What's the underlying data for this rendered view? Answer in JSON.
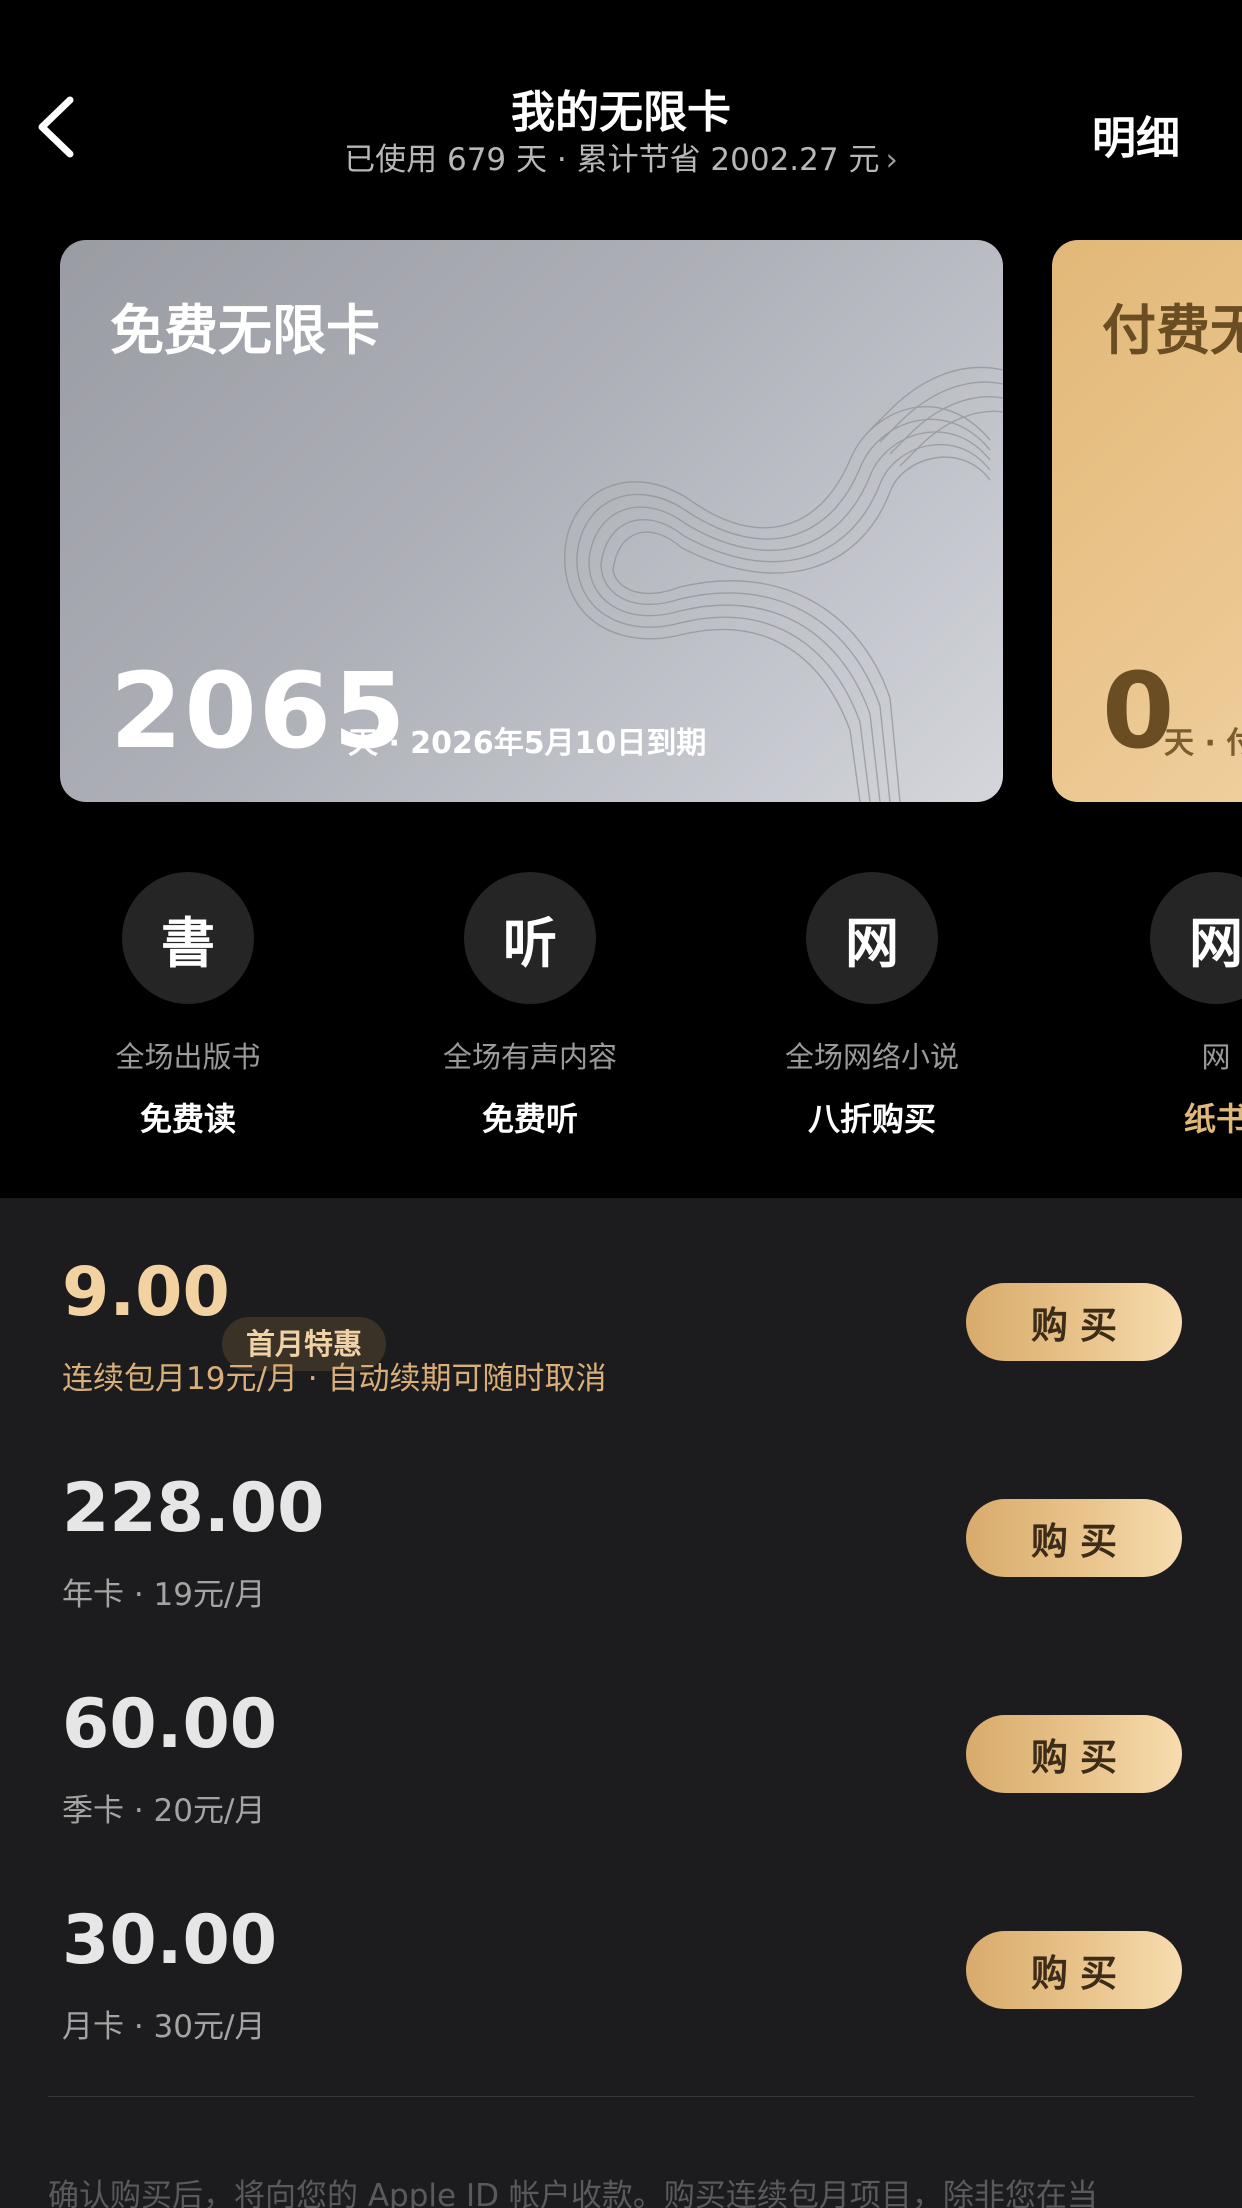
{
  "header": {
    "title": "我的无限卡",
    "subtitle": "已使用 679 天 · 累计节省 2002.27 元",
    "detail_label": "明细"
  },
  "cards": [
    {
      "name": "免费无限卡",
      "days": "2065",
      "expiry": "天 · 2026年5月10日到期"
    },
    {
      "name": "付费无",
      "days": "0",
      "expiry": "天 · 付"
    }
  ],
  "benefits": [
    {
      "icon_char": "書",
      "desc": "全场出版书",
      "tag": "免费读"
    },
    {
      "icon_char": "听",
      "desc": "全场有声内容",
      "tag": "免费听"
    },
    {
      "icon_char": "网",
      "desc": "全场网络小说",
      "tag": "八折购买"
    },
    {
      "icon_char": "网",
      "desc": "网",
      "tag": "纸书"
    }
  ],
  "purchase_options": [
    {
      "price": "9.00",
      "badge": "首月特惠",
      "desc": "连续包月19元/月 · 自动续期可随时取消",
      "button": "购买"
    },
    {
      "price": "228.00",
      "desc": "年卡 · 19元/月",
      "button": "购买"
    },
    {
      "price": "60.00",
      "desc": "季卡 · 20元/月",
      "button": "购买"
    },
    {
      "price": "30.00",
      "desc": "月卡 · 30元/月",
      "button": "购买"
    }
  ],
  "notice": "确认购买后，将向您的 Apple ID 帐户收款。购买连续包月项目，除非您在当",
  "colors": {
    "background": "#000000",
    "panel": "#1c1c1e",
    "gold_accent": "#e9c48c",
    "free_card": "#aeb0b7",
    "paid_card": "#ecc892"
  }
}
